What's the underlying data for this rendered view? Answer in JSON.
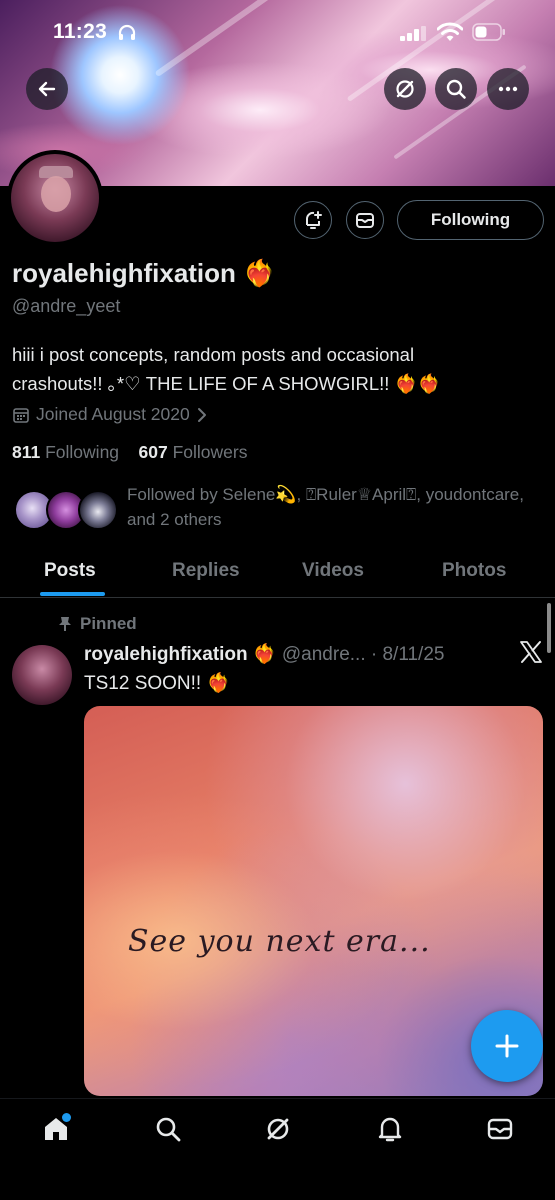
{
  "status_bar": {
    "time": "11:23"
  },
  "profile": {
    "display_name": "royalehighfixation",
    "name_emoji": "❤️‍🔥",
    "handle": "@andre_yeet",
    "bio_line1": "hiii i post concepts, random posts and occasional",
    "bio_line2": "crashouts!! ｡*♡ THE LIFE OF A SHOWGIRL!! ❤️‍🔥❤️‍🔥",
    "joined": "Joined August 2020",
    "following_count": "811",
    "following_label": "Following",
    "followers_count": "607",
    "followers_label": "Followers",
    "followed_by": "Followed by Selene💫, ⍰Ruler♕April⍰, youdontcare, and 2 others"
  },
  "buttons": {
    "follow_state": "Following"
  },
  "tabs": [
    {
      "label": "Posts",
      "active": true
    },
    {
      "label": "Replies",
      "active": false
    },
    {
      "label": "Videos",
      "active": false
    },
    {
      "label": "Photos",
      "active": false
    }
  ],
  "post": {
    "pinned_label": "Pinned",
    "author": "royalehighfixation",
    "author_emoji": "❤️‍🔥",
    "handle": "@andre...",
    "date": "· 8/11/25",
    "text": "TS12 SOON!! ❤️‍🔥",
    "image_text": "See you next era..."
  },
  "colors": {
    "accent": "#1d9bf0",
    "background": "#000000",
    "muted": "#71767b",
    "text": "#e7e9ea"
  },
  "icons": [
    "back-arrow-icon",
    "grok-icon",
    "search-icon",
    "more-icon",
    "add-notification-icon",
    "message-icon",
    "calendar-icon",
    "chevron-right-icon",
    "pin-icon",
    "x-logo-icon",
    "plus-icon",
    "home-icon",
    "explore-icon",
    "grok-nav-icon",
    "notifications-icon",
    "messages-nav-icon"
  ]
}
